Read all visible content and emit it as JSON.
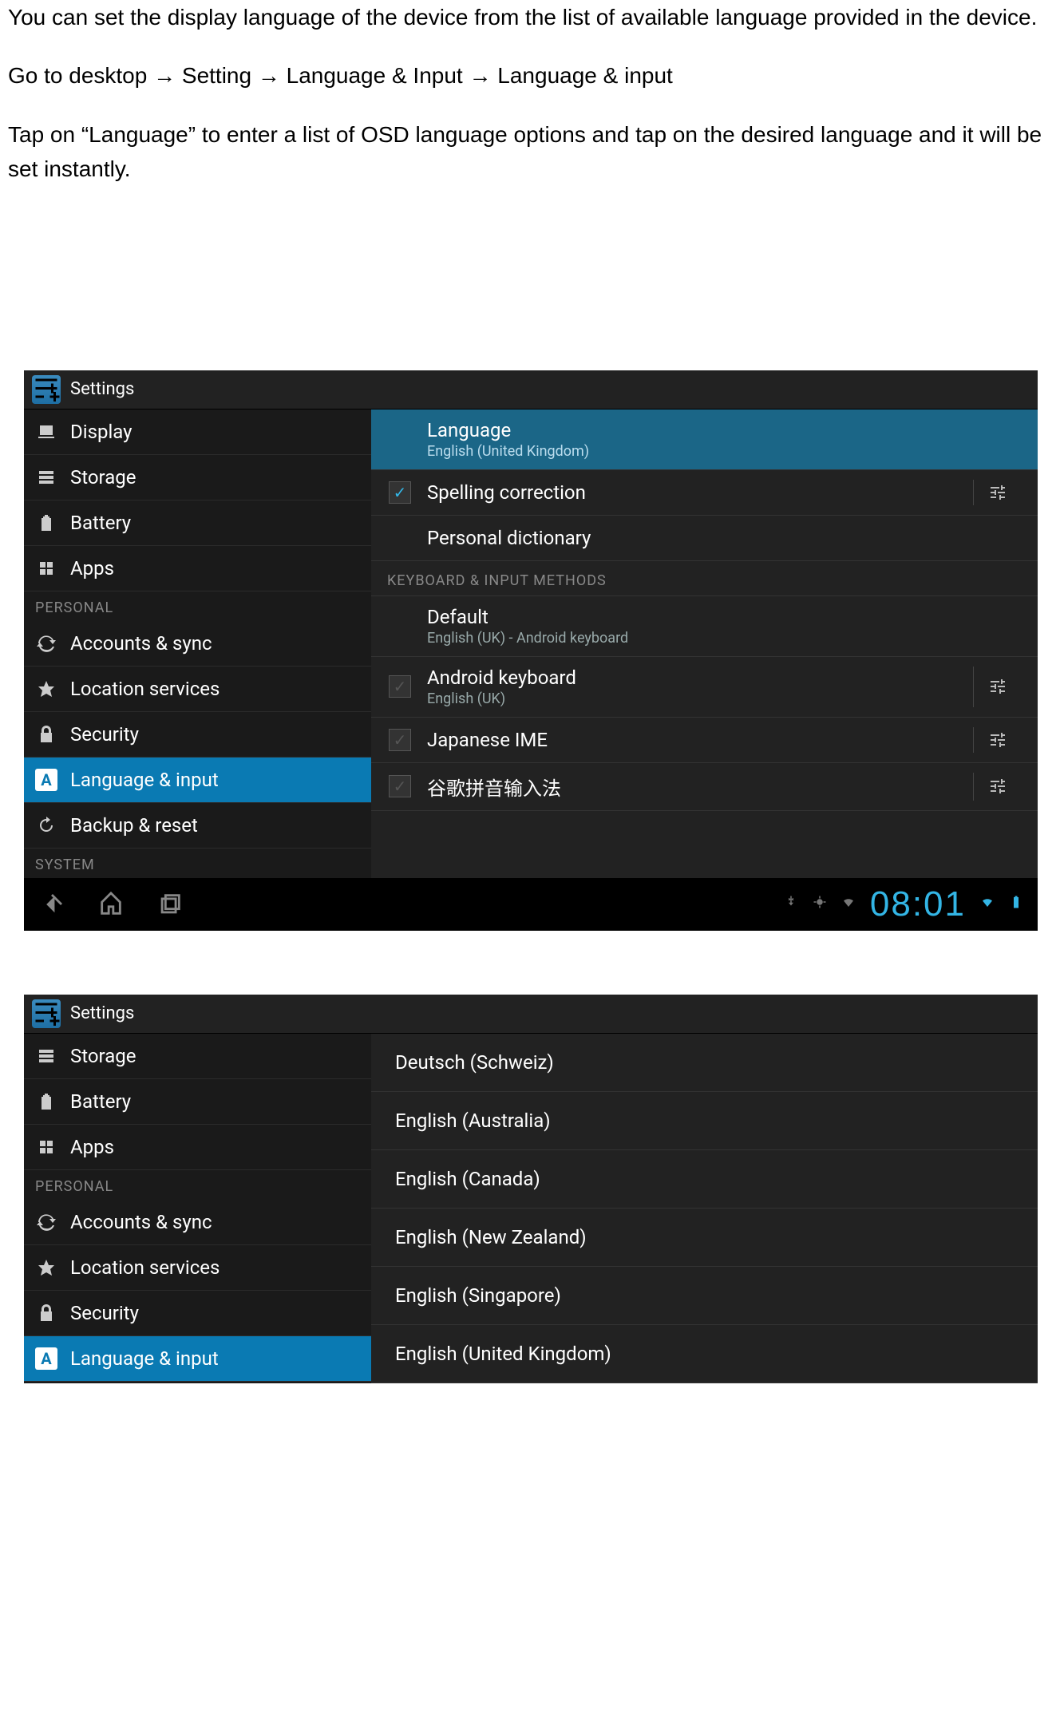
{
  "intro": {
    "p1": "You can set the display language of the device from the list of available language provided in the device.",
    "p2_prefix": "Go to desktop ",
    "p2_s1": " Setting ",
    "p2_s2": " Language & Input ",
    "p2_s3": " Language & input",
    "arrow": "→",
    "p3": "Tap on “Language” to enter a list of OSD language options and tap on the desired language and it will be set instantly."
  },
  "shot1": {
    "title": "Settings",
    "sidebar": {
      "items_top": [
        {
          "label": "Display"
        },
        {
          "label": "Storage"
        },
        {
          "label": "Battery"
        },
        {
          "label": "Apps"
        }
      ],
      "header_personal": "PERSONAL",
      "items_personal": [
        {
          "label": "Accounts & sync"
        },
        {
          "label": "Location services"
        },
        {
          "label": "Security"
        },
        {
          "label": "Language & input",
          "active": true
        },
        {
          "label": "Backup & reset"
        }
      ],
      "header_system": "SYSTEM"
    },
    "content": {
      "language": {
        "title": "Language",
        "sub": "English (United Kingdom)"
      },
      "spelling": {
        "title": "Spelling correction"
      },
      "personal_dict": {
        "title": "Personal dictionary"
      },
      "header_kb": "KEYBOARD & INPUT METHODS",
      "default": {
        "title": "Default",
        "sub": "English (UK) - Android keyboard"
      },
      "android_kb": {
        "title": "Android keyboard",
        "sub": "English (UK)"
      },
      "japanese": {
        "title": "Japanese IME"
      },
      "google_pinyin": {
        "title": "谷歌拼音输入法"
      }
    },
    "clock": "08:01"
  },
  "shot2": {
    "title": "Settings",
    "sidebar": {
      "items_top": [
        {
          "label": "Storage"
        },
        {
          "label": "Battery"
        },
        {
          "label": "Apps"
        }
      ],
      "header_personal": "PERSONAL",
      "items_personal": [
        {
          "label": "Accounts & sync"
        },
        {
          "label": "Location services"
        },
        {
          "label": "Security"
        },
        {
          "label": "Language & input",
          "active": true
        }
      ]
    },
    "languages": [
      "Deutsch (Schweiz)",
      "English (Australia)",
      "English (Canada)",
      "English (New Zealand)",
      "English (Singapore)",
      "English (United Kingdom)"
    ]
  }
}
